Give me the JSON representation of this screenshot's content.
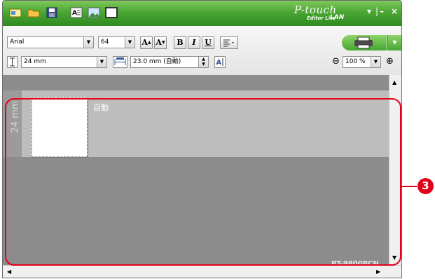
{
  "titlebar": {
    "brand_main": "P-touch",
    "brand_sub": "Editor Lite",
    "brand_lan": "LAN",
    "window_controls": [
      "▾",
      "|",
      "–",
      "×"
    ],
    "quick_buttons": [
      "new-label-icon",
      "open-icon",
      "save-icon",
      "text-icon",
      "image-icon",
      "frame-icon"
    ]
  },
  "toolbar": {
    "font": "Arial",
    "font_size": "64",
    "grow_label": "A",
    "shrink_label": "A",
    "bold_label": "B",
    "italic_label": "I",
    "underline_label": "U",
    "tape_width": "24 mm",
    "label_length": "23.0 mm (自動)",
    "zoom": "100 %",
    "zoom_minus": "⊖",
    "zoom_plus": "⊕"
  },
  "canvas": {
    "auto_label": "自動",
    "tape_size": "24 mm",
    "printer_model": "PT-9800PCN"
  },
  "callout": {
    "number": "3"
  },
  "colors": {
    "title_green": "#4aa733",
    "callout_red": "#e3001b",
    "canvas_gray": "#8c8c8c"
  }
}
